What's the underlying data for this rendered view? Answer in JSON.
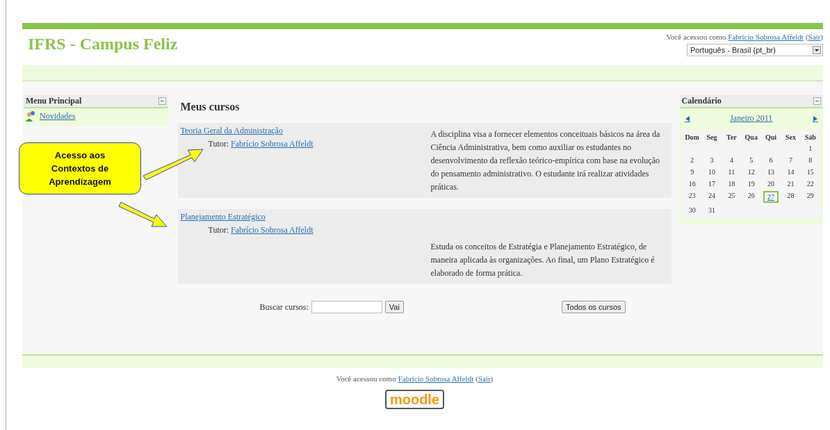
{
  "site_title": "IFRS - Campus Feliz",
  "login": {
    "prefix": "Você acessou como",
    "user": "Fabrício Sobrosa Affeldt",
    "open": "(",
    "logout": "Sair",
    "close": ")"
  },
  "language": {
    "value": "Português - Brasil (pt_br)"
  },
  "main_menu": {
    "title": "Menu Principal",
    "items": [
      {
        "label": "Novidades"
      }
    ]
  },
  "callout": {
    "text": "Acesso aos Contextos de Aprendizagem"
  },
  "courses_heading": "Meus cursos",
  "courses": [
    {
      "name": "Teoria Geral da Administração",
      "tutor_label": "Tutor:",
      "tutor": "Fabrício Sobrosa Affeldt",
      "description": "A disciplina visa a fornecer elementos conceituais básicos na área da Ciência Administrativa, bem como auxiliar os estudantes no desenvolvimento da reflexão teórico-empírica com base na evolução do pensamento administrativo. O estudante irá realizar atividades práticas."
    },
    {
      "name": "Planejamento Estratégico",
      "tutor_label": "Tutor:",
      "tutor": "Fabrício Sobrosa Affeldt",
      "description": "Estuda os conceitos de Estratégia e Planejamento Estratégico, de maneira aplicada às organizações. Ao final, um Plano Estratégico é elaborado de forma prática."
    }
  ],
  "search": {
    "label": "Buscar cursos:",
    "button": "Vai"
  },
  "all_courses_button": "Todos os cursos",
  "calendar": {
    "title": "Calendário",
    "month": "Janeiro 2011",
    "weekdays": [
      "Dom",
      "Seg",
      "Ter",
      "Qua",
      "Qui",
      "Sex",
      "Sáb"
    ],
    "weeks": [
      [
        {
          "day": "1",
          "today": false
        }
      ],
      [
        {
          "day": "2",
          "today": false
        },
        {
          "day": "3",
          "today": false
        },
        {
          "day": "4",
          "today": false
        },
        {
          "day": "5",
          "today": false
        },
        {
          "day": "6",
          "today": false
        },
        {
          "day": "7",
          "today": false
        },
        {
          "day": "8",
          "today": false
        }
      ],
      [
        {
          "day": "9",
          "today": false
        },
        {
          "day": "10",
          "today": false
        },
        {
          "day": "11",
          "today": false
        },
        {
          "day": "12",
          "today": false
        },
        {
          "day": "13",
          "today": false
        },
        {
          "day": "14",
          "today": false
        },
        {
          "day": "15",
          "today": false
        }
      ],
      [
        {
          "day": "16",
          "today": false
        },
        {
          "day": "17",
          "today": false
        },
        {
          "day": "18",
          "today": false
        },
        {
          "day": "19",
          "today": false
        },
        {
          "day": "20",
          "today": false
        },
        {
          "day": "21",
          "today": false
        },
        {
          "day": "22",
          "today": false
        }
      ],
      [
        {
          "day": "23",
          "today": false
        },
        {
          "day": "24",
          "today": false
        },
        {
          "day": "25",
          "today": false
        },
        {
          "day": "26",
          "today": false
        },
        {
          "day": "27",
          "today": true
        },
        {
          "day": "28",
          "today": false
        },
        {
          "day": "29",
          "today": false
        }
      ],
      [
        {
          "day": "30",
          "today": false
        },
        {
          "day": "31",
          "today": false
        }
      ]
    ]
  },
  "footer_login": {
    "prefix": "Você acessou como",
    "user": "Fabrício Sobrosa Affeldt",
    "open": "(",
    "logout": "Sair",
    "close": ")"
  },
  "footer_logo": "moodle"
}
